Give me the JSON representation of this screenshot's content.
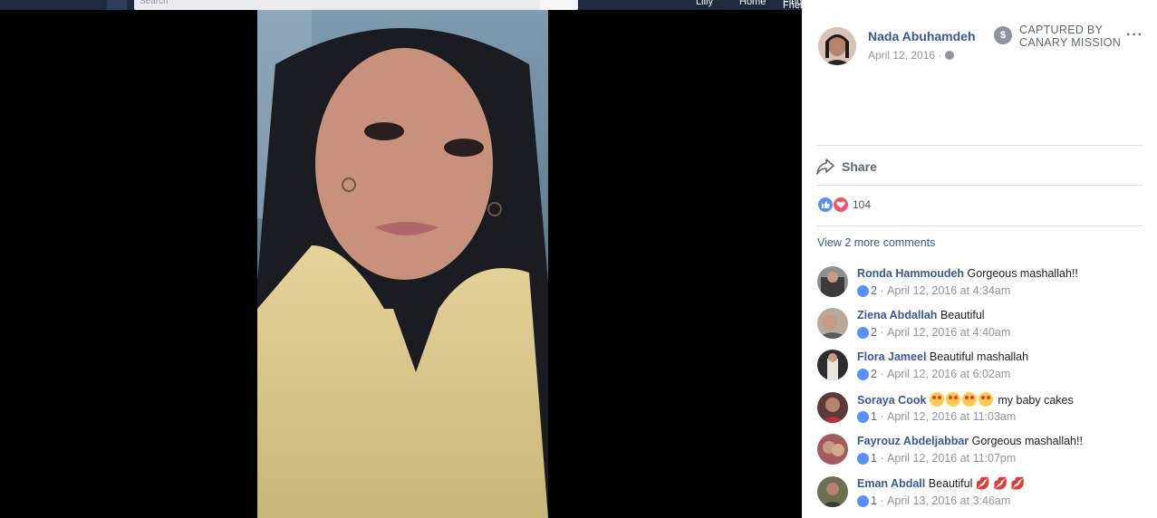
{
  "topbar": {
    "search_placeholder": "Search",
    "nav_links": [
      "Lilly",
      "Home",
      "Find Friends"
    ]
  },
  "post": {
    "author": "Nada Abuhamdeh",
    "date": "April 12, 2016 ·",
    "watermark_line1": "CAPTURED BY",
    "watermark_line2": "CANARY MISSION",
    "more_label": "···",
    "share_label": "Share",
    "reaction_count": "104",
    "view_more_comments": "View 2 more comments"
  },
  "comments": [
    {
      "name": "Ronda Hammoudeh",
      "text": "Gorgeous mashallah!!",
      "likes": "2",
      "time": "April 12, 2016 at 4:34am"
    },
    {
      "name": "Ziena Abdallah",
      "text": "Beautiful",
      "likes": "2",
      "time": "April 12, 2016 at 4:40am"
    },
    {
      "name": "Flora Jameel",
      "text": "Beautiful mashallah",
      "likes": "2",
      "time": "April 12, 2016 at 6:02am"
    },
    {
      "name": "Soraya Cook",
      "text": "my baby cakes",
      "likes": "1",
      "time": "April 12, 2016 at 11:03am"
    },
    {
      "name": "Fayrouz Abdeljabbar",
      "text": "Gorgeous mashallah!!",
      "likes": "1",
      "time": "April 12, 2016 at 11:07pm"
    },
    {
      "name": "Eman Abdall",
      "text": "Beautiful",
      "likes": "1",
      "time": "April 13, 2016 at 3:46am"
    }
  ],
  "colors": {
    "link": "#385898",
    "meta": "#90949c",
    "like_blue": "#5890ff",
    "love_red": "#f25268"
  }
}
